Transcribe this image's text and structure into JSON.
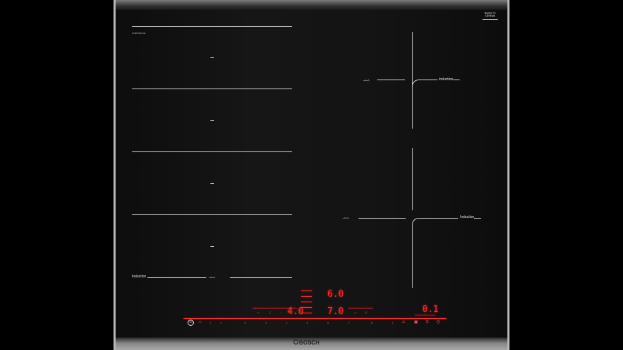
{
  "model_number": "PXE875DC1E",
  "brand_badge": {
    "line1": "SCHOTT",
    "line2": "CERAN"
  },
  "zones": {
    "left_zone_label": "Induction",
    "left_zone_symbol": "ᴗᴧᴗᴧ",
    "right_top_label": "Induction",
    "right_top_symbol": "ᴗᴧᴗᴧ",
    "right_bottom_label": "Induction",
    "right_bottom_symbol": "ᴗᴧᴗᴧ"
  },
  "display": {
    "top_reading": "6.0",
    "left_reading": "4.0",
    "center_reading": "7.0",
    "right_reading": "0.1"
  },
  "slider": {
    "numbers": [
      "0",
      "1",
      "2",
      "3",
      "4",
      "5",
      "6",
      "7",
      "8",
      "9"
    ]
  },
  "footer": {
    "brand": "BOSCH"
  },
  "colors": {
    "display_red": "#ff2a2a",
    "glass": "#141414",
    "frame": "#b9b9b9"
  }
}
